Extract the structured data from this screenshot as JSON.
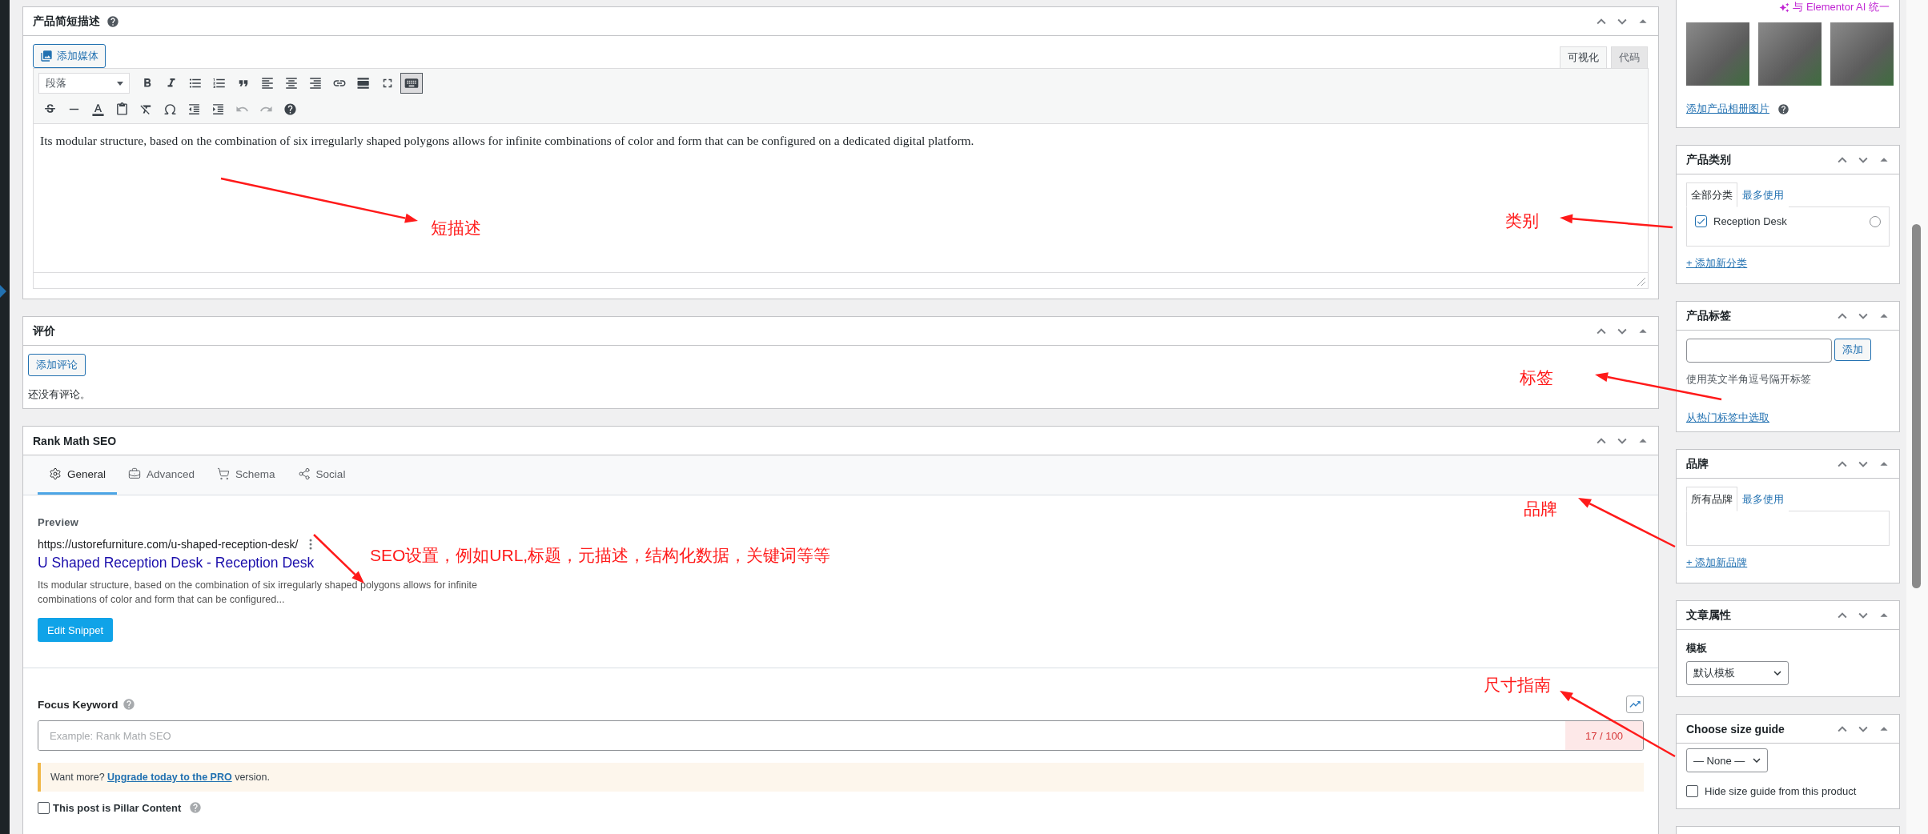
{
  "short_description": {
    "title": "产品简短描述",
    "add_media": "添加媒体",
    "tabs": [
      {
        "label": "可视化",
        "selected": true
      },
      {
        "label": "代码",
        "selected": false
      }
    ],
    "format_select": "段落",
    "toolbar_toggle_on": true,
    "content": "Its modular structure, based on the combination of six irregularly shaped polygons allows for infinite combinations of color and form that can be configured on a dedicated digital platform."
  },
  "reviews": {
    "title": "评价",
    "add_button": "添加评论",
    "empty_text": "还没有评论。"
  },
  "rank_math": {
    "title": "Rank Math SEO",
    "tabs": [
      {
        "label": "General",
        "selected": true
      },
      {
        "label": "Advanced",
        "selected": false
      },
      {
        "label": "Schema",
        "selected": false
      },
      {
        "label": "Social",
        "selected": false
      }
    ],
    "preview_label": "Preview",
    "url": "https://ustorefurniture.com/u-shaped-reception-desk/",
    "seo_title": "U Shaped Reception Desk - Reception Desk",
    "description": "Its modular structure, based on the combination of six irregularly shaped polygons allows for infinite combinations of color and form that can be configured...",
    "edit_button": "Edit Snippet",
    "focus_label": "Focus Keyword",
    "focus_placeholder": "Example: Rank Math SEO",
    "counter": "17 / 100",
    "notice_before": "Want more? ",
    "notice_link": "Upgrade today to the PRO",
    "notice_after": " version.",
    "pillar_label": "This post is Pillar Content",
    "pillar_checked": false
  },
  "sidebar": {
    "gallery": {
      "ai_link": "与 Elementor AI 统一",
      "add_link": "添加产品相册图片"
    },
    "categories": {
      "title": "产品类别",
      "tabs": [
        {
          "label": "全部分类",
          "selected": true
        },
        {
          "label": "最多使用",
          "selected": false
        }
      ],
      "items": [
        {
          "label": "Reception Desk",
          "checked": true,
          "primary": false
        }
      ],
      "add_link": "+ 添加新分类"
    },
    "tags": {
      "title": "产品标签",
      "add_button": "添加",
      "hint": "使用英文半角逗号隔开标签",
      "popular_link": "从热门标签中选取"
    },
    "brands": {
      "title": "品牌",
      "tabs": [
        {
          "label": "所有品牌",
          "selected": true
        },
        {
          "label": "最多使用",
          "selected": false
        }
      ],
      "add_link": "+ 添加新品牌"
    },
    "attributes": {
      "title": "文章属性",
      "template_label": "模板",
      "template_value": "默认模板"
    },
    "size_guide": {
      "title": "Choose size guide",
      "select_value": "— None —",
      "hide_label": "Hide size guide from this product",
      "hide_checked": false
    }
  },
  "annotations": [
    {
      "text": "短描述"
    },
    {
      "text": "类别"
    },
    {
      "text": "标签"
    },
    {
      "text": "品牌"
    },
    {
      "text": "SEO设置，例如URL,标题，元描述，结构化数据，关键词等等"
    },
    {
      "text": "尺寸指南"
    }
  ]
}
